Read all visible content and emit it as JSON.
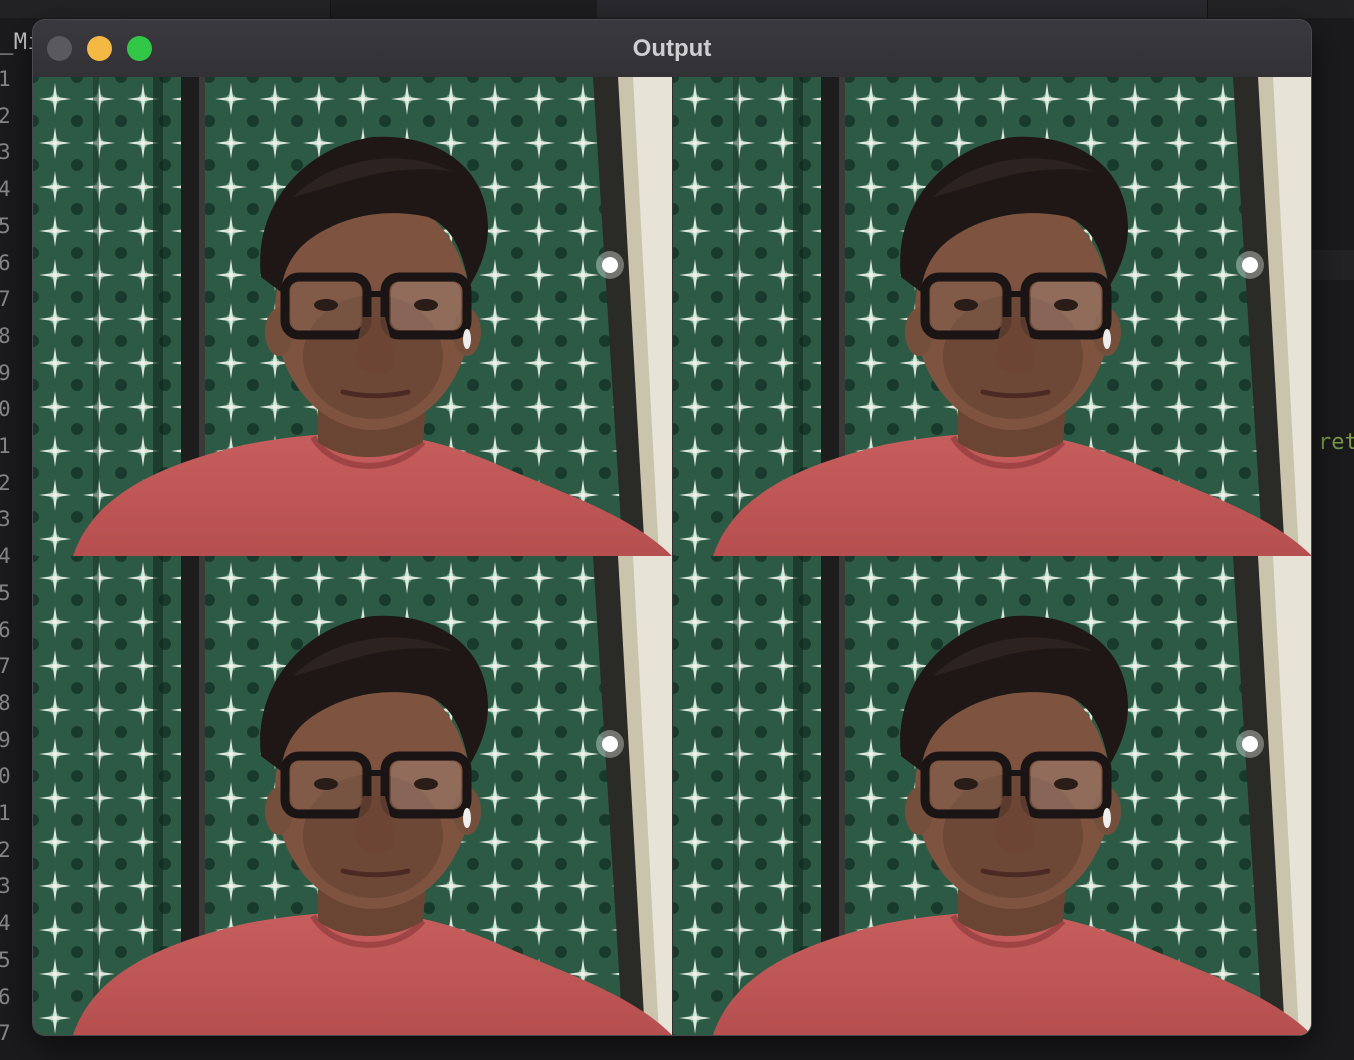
{
  "editor": {
    "filename_fragment": "_Mi",
    "line_numbers": [
      "1",
      "2",
      "3",
      "4",
      "5",
      "6",
      "7",
      "8",
      "9",
      "0",
      "1",
      "2",
      "3",
      "4",
      "5",
      "6",
      "7",
      "8",
      "9",
      "0",
      "1",
      "2",
      "3",
      "4",
      "5",
      "6",
      "7"
    ],
    "code_fragment": "ret"
  },
  "window": {
    "title": "Output",
    "traffic_lights": {
      "close": {
        "icon": "close-dot-icon",
        "color": "#5a595e"
      },
      "minimize": {
        "icon": "minimize-dot-icon",
        "color": "#f4b844"
      },
      "zoom": {
        "icon": "zoom-dot-icon",
        "color": "#33c748"
      }
    }
  },
  "output": {
    "grid": {
      "rows": 2,
      "cols": 2
    },
    "frames": [
      {
        "label": "webcam frame top-left"
      },
      {
        "label": "webcam frame top-right"
      },
      {
        "label": "webcam frame bottom-left"
      },
      {
        "label": "webcam frame bottom-right"
      }
    ]
  }
}
